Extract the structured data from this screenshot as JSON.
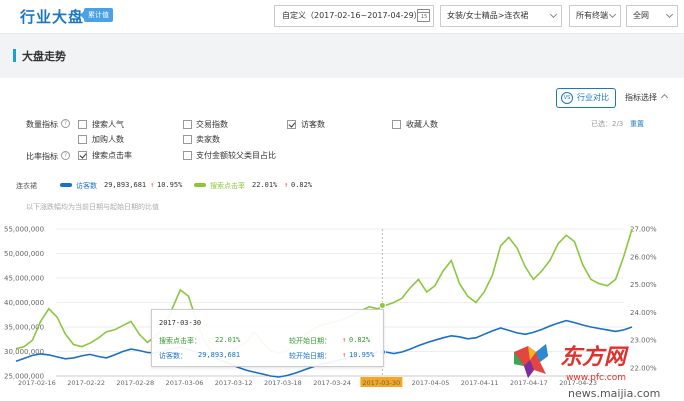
{
  "header": {
    "title": "行业大盘",
    "badge": "累计值",
    "date_range": "自定义（2017-02-16~2017-04-29）",
    "calendar_icon": "calendar-icon",
    "calendar_day": "15",
    "category": "女装/女士精品>连衣裙",
    "terminal": "所有终端",
    "network": "全网"
  },
  "section": {
    "title": "大盘走势"
  },
  "toolbar": {
    "industry_compare": "行业对比",
    "vs_icon": "VS",
    "metric_select": "指标选择"
  },
  "metrics": {
    "quantity_label": "数量指标",
    "ratio_label": "比率指标",
    "help": "?",
    "selected_count": "已选：2/3",
    "reset": "重置",
    "options": [
      {
        "label": "搜索人气",
        "checked": false
      },
      {
        "label": "交易指数",
        "checked": false
      },
      {
        "label": "访客数",
        "checked": true
      },
      {
        "label": "收藏人数",
        "checked": false
      },
      {
        "label": "加购人数",
        "checked": false
      },
      {
        "label": "卖家数",
        "checked": false
      },
      {
        "label": "搜索点击率",
        "checked": true
      },
      {
        "label": "支付金额较父类目占比",
        "checked": false
      }
    ]
  },
  "legend": {
    "label": "连衣裙",
    "series1": {
      "name": "访客数",
      "value": "29,893,681",
      "change": "10.95%",
      "color": "#1a6fc9"
    },
    "series2": {
      "name": "搜索点击率",
      "value": "22.01%",
      "change": "0.82%",
      "color": "#8cc63f"
    },
    "note": "以下涨跌幅均为当前日期与起始日期的比值"
  },
  "tooltip": {
    "date": "2017-03-30",
    "row1_name": "搜索点击率：",
    "row1_value": "22.01%",
    "row1_cmp": "较开始日期：",
    "row1_change": "0.82%",
    "row2_name": "访客数：",
    "row2_value": "29,893,681",
    "row2_cmp": "较开始日期：",
    "row2_change": "10.95%"
  },
  "watermark": {
    "brand": "东方网",
    "site": "www.pfc.com",
    "url": "news.maijia.com"
  },
  "chart_data": {
    "type": "line",
    "left_axis_ticks": [
      "25,000,000",
      "30,000,000",
      "35,000,000",
      "40,000,000",
      "45,000,000",
      "50,000,000",
      "55,000,000"
    ],
    "right_axis_ticks": [
      "22.00%",
      "23.00%",
      "24.00%",
      "25.00%",
      "26.00%",
      "27.00%"
    ],
    "x_ticks": [
      "2017-02-16",
      "2017-02-22",
      "2017-02-28",
      "2017-03-06",
      "2017-03-12",
      "2017-03-18",
      "2017-03-24",
      "2017-03-30",
      "2017-04-05",
      "2017-04-11",
      "2017-04-17",
      "2017-04-23"
    ],
    "highlight_date": "2017-03-30",
    "left_ylim": [
      25000000,
      55000000
    ],
    "right_ylim": [
      20000000,
      55000000
    ],
    "series": [
      {
        "name": "访客数",
        "axis": "left",
        "color": "#1a6fc9",
        "values": [
          28000000,
          28600000,
          29200000,
          29500000,
          29300000,
          28900000,
          28500000,
          28700000,
          29100000,
          29400000,
          29000000,
          28700000,
          29300000,
          30000000,
          30500000,
          30200000,
          29800000,
          29700000,
          30100000,
          30500000,
          30900000,
          30400000,
          29800000,
          29400000,
          28900000,
          28200000,
          27500000,
          26800000,
          26200000,
          25800000,
          25400000,
          25000000,
          24800000,
          25100000,
          25600000,
          26200000,
          26800000,
          27300000,
          27700000,
          28100000,
          28500000,
          28900000,
          29200000,
          29600000,
          29900000,
          29893681,
          29600000,
          29900000,
          30500000,
          31200000,
          31800000,
          32300000,
          32800000,
          33200000,
          33000000,
          32600000,
          32800000,
          33500000,
          34200000,
          34800000,
          34300000,
          33800000,
          33500000,
          33900000,
          34500000,
          35200000,
          35800000,
          36300000,
          35900000,
          35400000,
          35000000,
          34700000,
          34400000,
          34100000,
          34400000,
          35000000
        ]
      },
      {
        "name": "搜索点击率",
        "axis": "right",
        "color": "#8cc63f",
        "values": [
          26500000,
          27000000,
          28500000,
          33000000,
          36000000,
          34000000,
          30000000,
          27500000,
          27000000,
          27800000,
          29000000,
          30500000,
          31000000,
          32000000,
          33000000,
          30000000,
          28000000,
          29500000,
          31500000,
          36000000,
          40500000,
          39000000,
          33000000,
          28000000,
          25500000,
          25000000,
          25500000,
          27000000,
          28000000,
          30500000,
          28000000,
          26000000,
          25500000,
          26000000,
          28000000,
          29500000,
          31000000,
          32000000,
          32500000,
          33000000,
          33500000,
          34500000,
          35500000,
          36500000,
          36000000,
          36800000,
          37500000,
          38500000,
          41000000,
          43000000,
          40000000,
          41500000,
          45000000,
          47500000,
          42000000,
          39000000,
          37500000,
          40000000,
          44000000,
          51000000,
          53000000,
          50500000,
          46000000,
          43000000,
          45000000,
          47500000,
          51500000,
          53500000,
          52000000,
          46500000,
          43000000,
          42000000,
          41500000,
          43000000,
          48500000,
          55000000
        ]
      }
    ]
  }
}
